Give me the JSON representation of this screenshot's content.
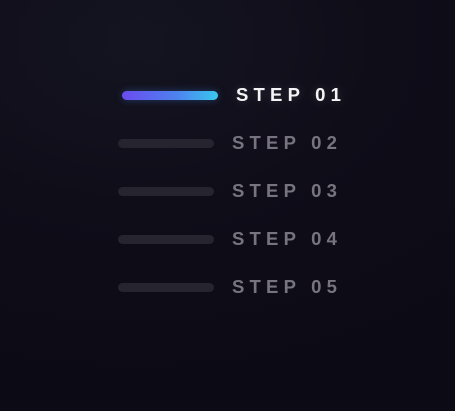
{
  "steps": [
    {
      "label": "STEP 01",
      "active": true
    },
    {
      "label": "STEP 02",
      "active": false
    },
    {
      "label": "STEP 03",
      "active": false
    },
    {
      "label": "STEP 04",
      "active": false
    },
    {
      "label": "STEP 05",
      "active": false
    }
  ],
  "colors": {
    "background": "#0f0d18",
    "inactive_bar": "#26242e",
    "inactive_text": "#77747f",
    "active_text": "#f4f4f6",
    "active_gradient_start": "#6a4cf0",
    "active_gradient_end": "#39c7ee"
  }
}
